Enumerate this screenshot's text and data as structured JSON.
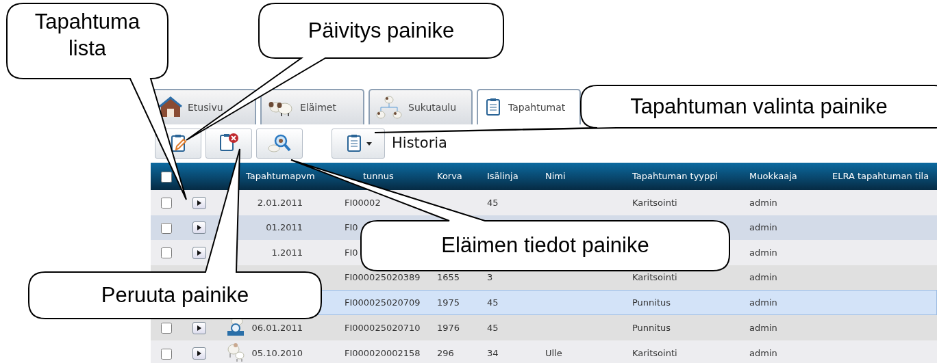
{
  "tabs": [
    {
      "label": "Etusivu",
      "kind": "home",
      "selected": false
    },
    {
      "label": "Eläimet",
      "kind": "animals",
      "selected": false
    },
    {
      "label": "Sukutaulu",
      "kind": "pedigree",
      "selected": false
    },
    {
      "label": "Tapahtumat",
      "kind": "events",
      "selected": true
    }
  ],
  "toolbar": {
    "buttons": [
      {
        "kind": "edit"
      },
      {
        "kind": "cancel"
      },
      {
        "kind": "search"
      },
      {
        "kind": "select"
      }
    ],
    "label": "Historia"
  },
  "table": {
    "header_checked": false,
    "columns": [
      "",
      "",
      "",
      "Tapahtumapvm",
      "tunnus",
      "Korva",
      "Isälinja",
      "Nimi",
      "Tapahtuman tyyppi",
      "Muokkaaja",
      "ELRA tapahtuman tila"
    ],
    "rows": [
      {
        "checked": false,
        "selected": false,
        "date": "2.01.2011",
        "id": "FI00002",
        "isalinja": "45",
        "tyyppi": "Karitsointi",
        "muokkaaja": "admin"
      },
      {
        "checked": false,
        "selected": false,
        "highlighted": true,
        "date": "01.2011",
        "id": "FI0",
        "muokkaaja": "admin"
      },
      {
        "checked": false,
        "selected": false,
        "date": "1.2011",
        "id": "FI0",
        "muokkaaja": "admin"
      },
      {
        "selected": false,
        "id": "FI000025020389",
        "korva": "1655",
        "isalinja": "3",
        "tyyppi": "Karitsointi",
        "muokkaaja": "admin"
      },
      {
        "selected": true,
        "id": "FI000025020709",
        "korva": "1975",
        "isalinja": "45",
        "tyyppi": "Punnitus",
        "muokkaaja": "admin"
      },
      {
        "checked": false,
        "selected": false,
        "kind": "weighing",
        "date": "06.01.2011",
        "id": "FI000025020710",
        "korva": "1976",
        "isalinja": "45",
        "tyyppi": "Punnitus",
        "muokkaaja": "admin"
      },
      {
        "checked": false,
        "selected": false,
        "kind": "lambing",
        "date": "05.10.2010",
        "id": "FI000020002158",
        "korva": "296",
        "isalinja": "34",
        "nimi": "Ulle",
        "tyyppi": "Karitsointi",
        "muokkaaja": "admin"
      }
    ]
  },
  "callouts": [
    {
      "text": "Tapahtuma lista"
    },
    {
      "text": "Päivitys painike"
    },
    {
      "text": "Tapahtuman valinta painike"
    },
    {
      "text": "Eläimen tiedot painike"
    },
    {
      "text": "Peruuta painike"
    }
  ]
}
